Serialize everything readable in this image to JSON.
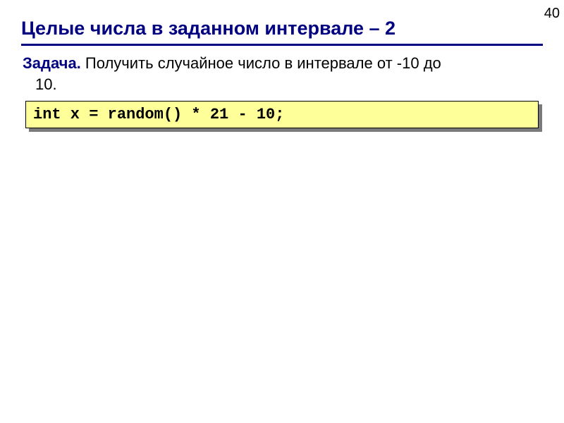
{
  "page_number": "40",
  "title": "Целые числа в заданном интервале – 2",
  "task": {
    "label": "Задача.",
    "text_part1": " Получить случайное число в интервале от -10 до",
    "text_part2": "10."
  },
  "code": "int x = random() * 21 - 10;"
}
